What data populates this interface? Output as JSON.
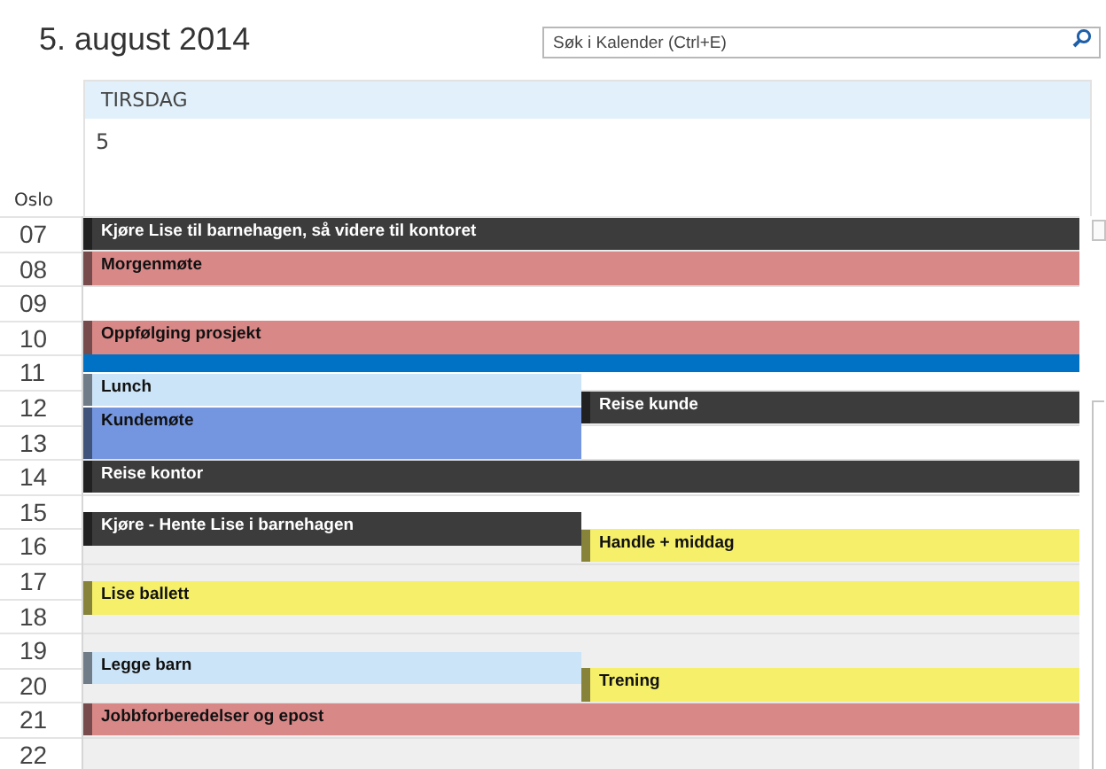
{
  "title": "5. august 2014",
  "search": {
    "placeholder": "Søk i Kalender (Ctrl+E)"
  },
  "day": {
    "weekday": "TIRSDAG",
    "date": "5"
  },
  "timezone": "Oslo",
  "hours": [
    {
      "label": "07",
      "selected": false
    },
    {
      "label": "08",
      "selected": false
    },
    {
      "label": "09",
      "selected": false
    },
    {
      "label": "10",
      "selected": false
    },
    {
      "label": "11",
      "selected": true
    },
    {
      "label": "12",
      "selected": false
    },
    {
      "label": "13",
      "selected": false
    },
    {
      "label": "14",
      "selected": false
    },
    {
      "label": "15",
      "selected": false
    },
    {
      "label": "16",
      "selected": false
    },
    {
      "label": "17",
      "selected": false
    },
    {
      "label": "18",
      "selected": false
    },
    {
      "label": "19",
      "selected": false
    },
    {
      "label": "20",
      "selected": false
    },
    {
      "label": "21",
      "selected": false
    },
    {
      "label": "22",
      "selected": false
    }
  ],
  "events": [
    {
      "title": "Kjøre Lise til barnehagen, så videre til kontoret",
      "color": "#3c3c3c"
    },
    {
      "title": "Morgenmøte",
      "color": "#d98888"
    },
    {
      "title": "Oppfølging prosjekt",
      "color": "#d98888"
    },
    {
      "title": "Lunch",
      "color": "#cce4f7"
    },
    {
      "title": "Reise kunde",
      "color": "#3c3c3c"
    },
    {
      "title": "Kundemøte",
      "color": "#7496e0"
    },
    {
      "title": "Reise kontor",
      "color": "#3c3c3c"
    },
    {
      "title": "Kjøre - Hente Lise i barnehagen",
      "color": "#3c3c3c"
    },
    {
      "title": "Handle + middag",
      "color": "#f5ef6a"
    },
    {
      "title": "Lise ballett",
      "color": "#f5ef6a"
    },
    {
      "title": "Legge barn",
      "color": "#cce4f7"
    },
    {
      "title": "Trening",
      "color": "#f5ef6a"
    },
    {
      "title": "Jobbforberedelser og epost",
      "color": "#d98888"
    }
  ]
}
